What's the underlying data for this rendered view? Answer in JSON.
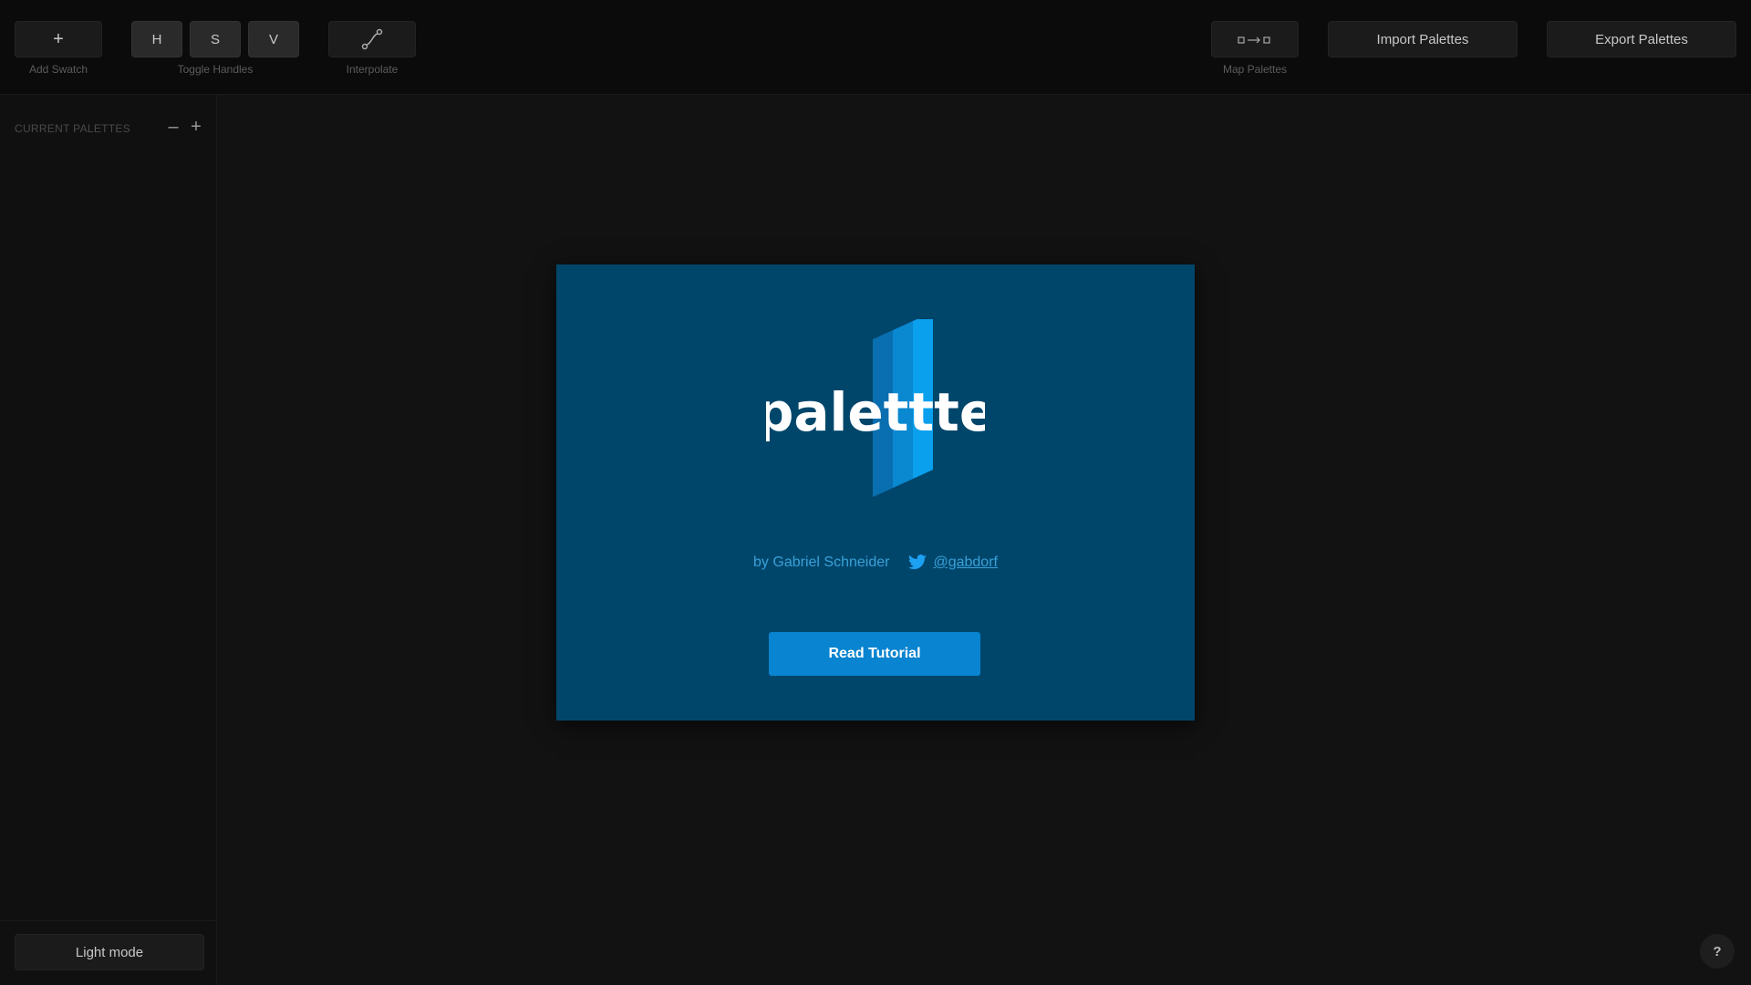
{
  "toolbar": {
    "add_swatch_symbol": "+",
    "add_swatch_label": "Add Swatch",
    "h_label": "H",
    "s_label": "S",
    "v_label": "V",
    "toggle_handles_label": "Toggle Handles",
    "interpolate_label": "Interpolate",
    "map_palettes_label": "Map Palettes",
    "import_label": "Import Palettes",
    "export_label": "Export Palettes"
  },
  "sidebar": {
    "title": "CURRENT PALETTES",
    "minus": "–",
    "plus": "+",
    "light_mode_label": "Light mode"
  },
  "modal": {
    "logo_text": "palettte",
    "author": "by Gabriel Schneider",
    "twitter_handle": "@gabdorf",
    "button_label": "Read Tutorial"
  },
  "help": "?",
  "colors": {
    "background": "#121212",
    "toolbar": "#0b0b0b",
    "modal": "#00466b",
    "accent": "#0884d0",
    "link": "#3aa0d8"
  }
}
